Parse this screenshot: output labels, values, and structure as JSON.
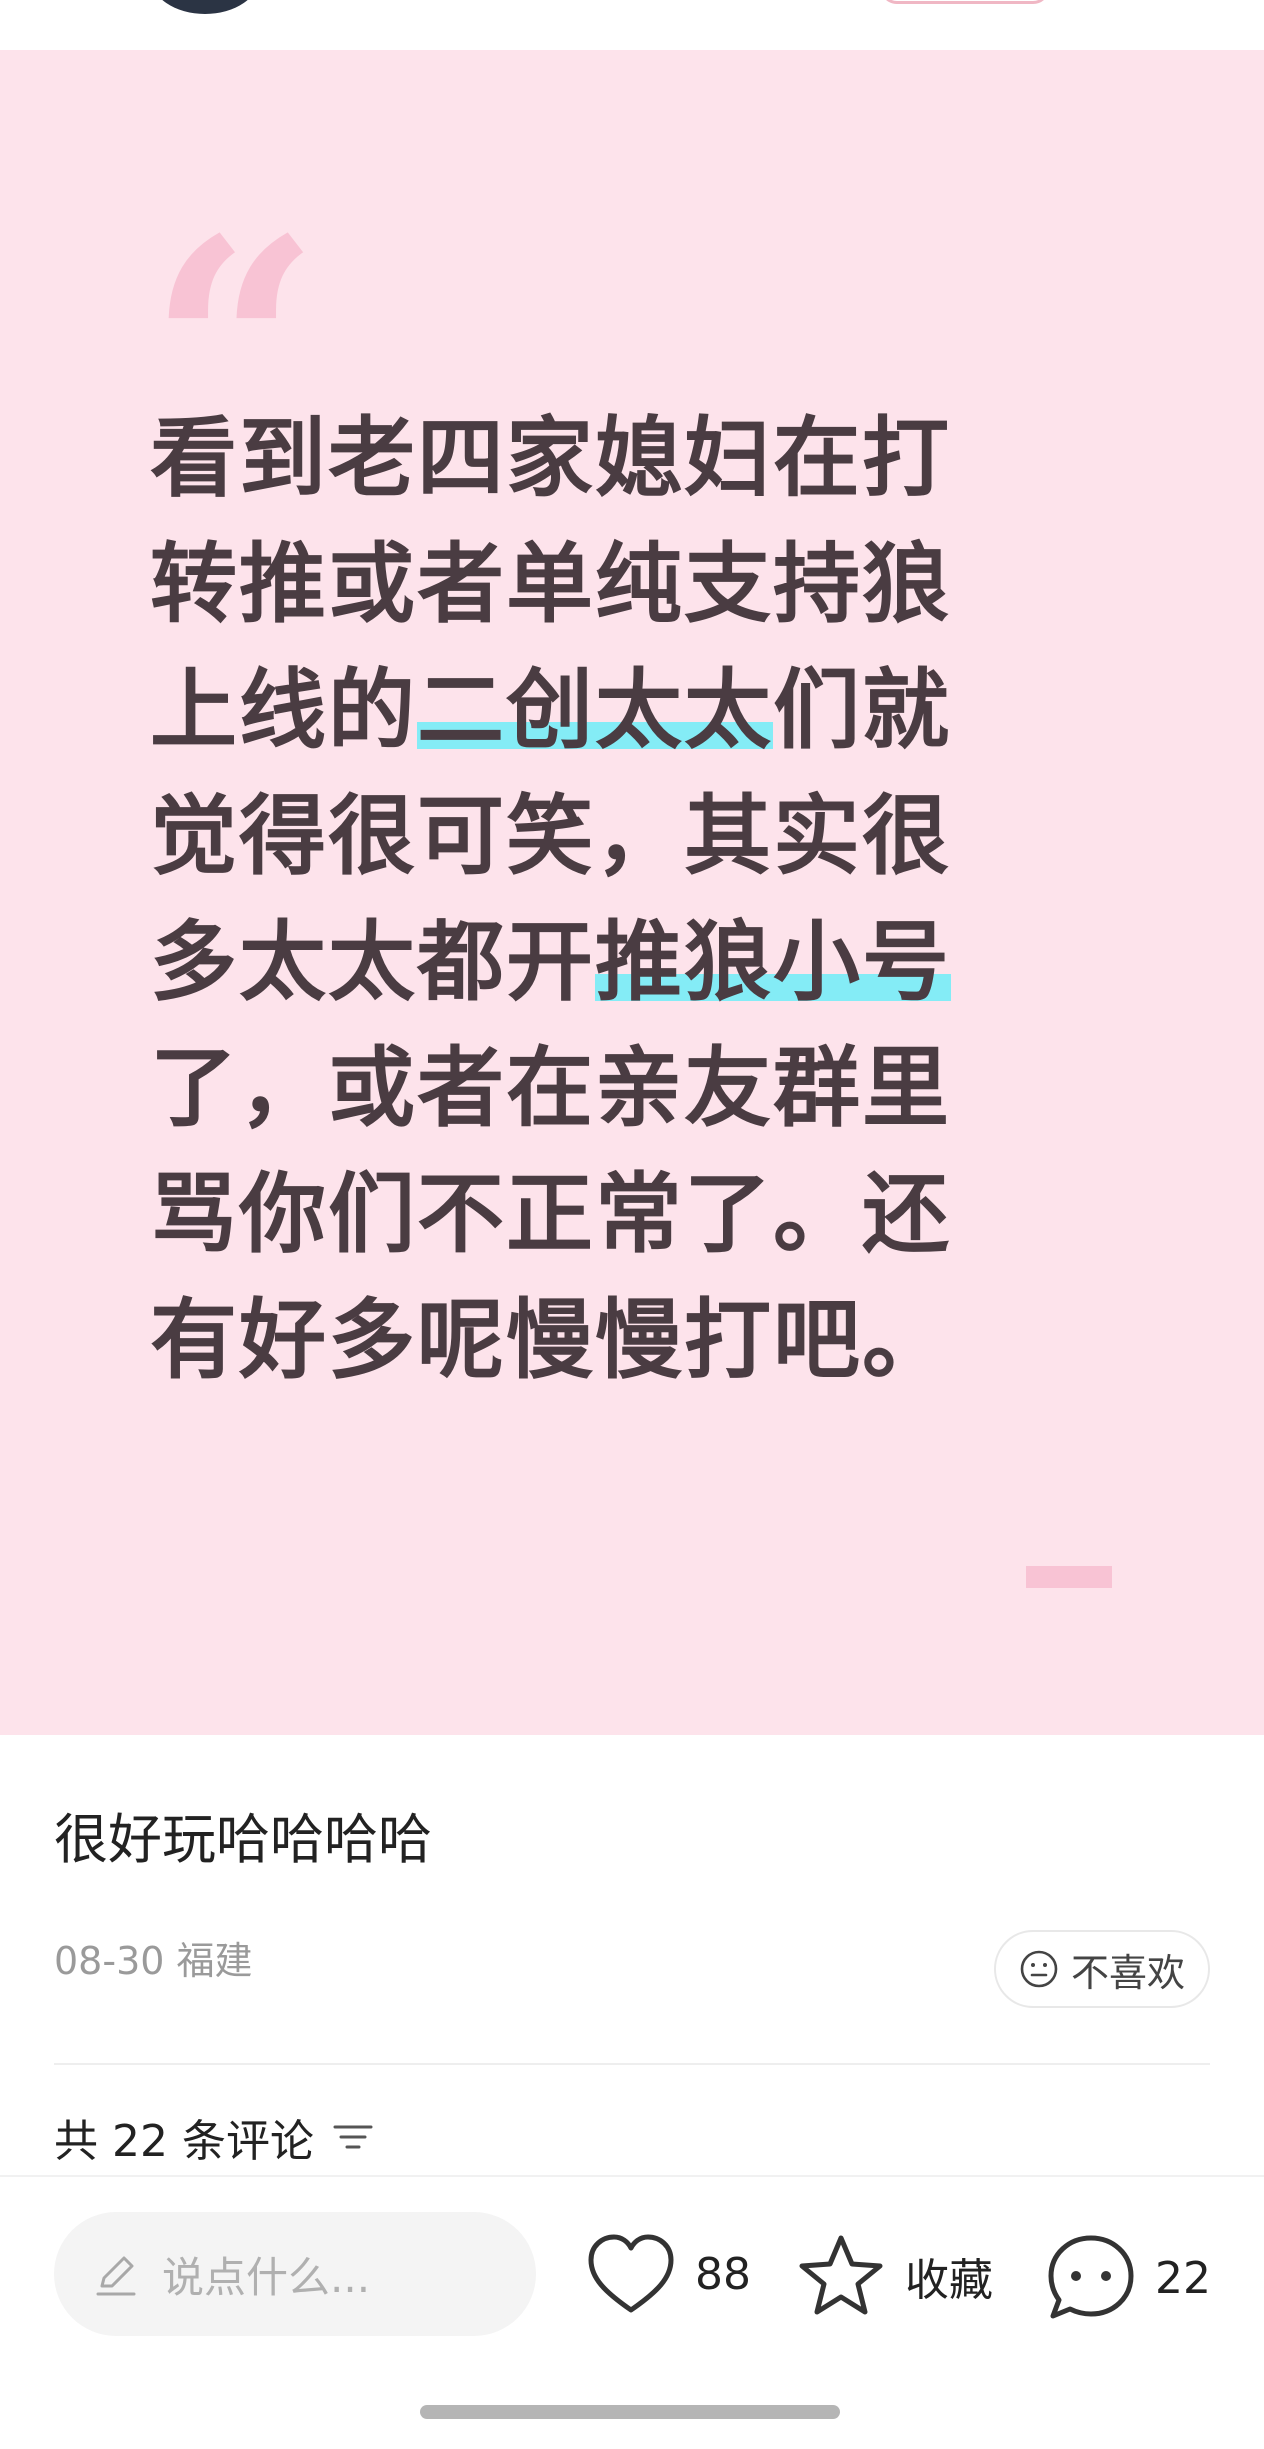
{
  "post": {
    "quote_lines": [
      [
        "看到老四家媳妇在打"
      ],
      [
        "转推或者单纯支持狼"
      ],
      [
        "上线的",
        {
          "hl": "二创太太"
        },
        "们就"
      ],
      [
        "觉得很可笑，其实很"
      ],
      [
        "多太太都开",
        {
          "hl": "推狼小号"
        }
      ],
      [
        "了，或者在亲友群里"
      ],
      [
        "骂你们不正常了。还"
      ],
      [
        "有好多呢慢慢打吧。"
      ]
    ],
    "title": "很好玩哈哈哈哈",
    "date": "08-30",
    "location": "福建",
    "dislike_label": "不喜欢",
    "comments_prefix": "共",
    "comments_count": "22",
    "comments_suffix": "条评论"
  },
  "bottom_bar": {
    "input_placeholder": "说点什么...",
    "likes": "88",
    "favorite_label": "收藏",
    "comments": "22"
  },
  "colors": {
    "card_background": "#fde3eb",
    "quote_text": "#4a3c42",
    "highlight": "#84ecf6",
    "accent_pink": "#f8c3d4"
  },
  "icons": [
    "pencil-icon",
    "heart-icon",
    "star-icon",
    "comment-bubble-icon",
    "neutral-face-icon",
    "sort-filter-icon"
  ]
}
